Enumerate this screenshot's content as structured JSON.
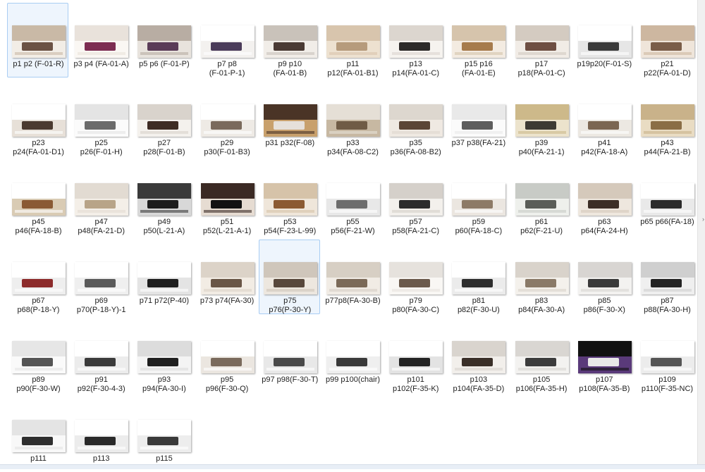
{
  "window": {
    "scroll_arrow": "›"
  },
  "catalog": [
    {
      "line1": "p1 p2 (F-01-R)",
      "line2": "",
      "selected": true,
      "palette": [
        "#c9b9a6",
        "#f2ede6",
        "#6b5244"
      ]
    },
    {
      "line1": "p3 p4 (FA-01-A)",
      "line2": "",
      "palette": [
        "#e9e2db",
        "#faf7f3",
        "#7d2d52"
      ]
    },
    {
      "line1": "p5 p6 (F-01-P)",
      "line2": "",
      "palette": [
        "#b8ada3",
        "#e8e3dd",
        "#5a3c58"
      ]
    },
    {
      "line1": "p7 p8",
      "line2": "(F-01-P-1)",
      "palette": [
        "#ffffff",
        "#f3f1ef",
        "#4b3c5a"
      ]
    },
    {
      "line1": "p9 p10",
      "line2": "(FA-01-B)",
      "palette": [
        "#c9c2ba",
        "#f1ede8",
        "#4a3a34"
      ]
    },
    {
      "line1": "p11",
      "line2": "p12(FA-01-B1)",
      "palette": [
        "#d8c5ad",
        "#ede1d0",
        "#b69b7c"
      ]
    },
    {
      "line1": "p13",
      "line2": "p14(FA-01-C)",
      "palette": [
        "#dcd6cf",
        "#f6f3ef",
        "#2d2a29"
      ]
    },
    {
      "line1": "p15 p16",
      "line2": "(FA-01-E)",
      "palette": [
        "#d6c4ac",
        "#f3ebe1",
        "#a67b4c"
      ]
    },
    {
      "line1": "p17",
      "line2": "p18(PA-01-C)",
      "palette": [
        "#d4cbc1",
        "#f1ece6",
        "#6e4f43"
      ]
    },
    {
      "line1": "p19p20(F-01-S)",
      "line2": "",
      "palette": [
        "#ffffff",
        "#e6e6e6",
        "#3a3a3a"
      ]
    },
    {
      "line1": "p21",
      "line2": "p22(FA-01-D)",
      "palette": [
        "#cdb7a0",
        "#efe5da",
        "#7a5d48"
      ]
    },
    {
      "line1": "p23",
      "line2": "p24(FA-01-D1)",
      "palette": [
        "#ffffff",
        "#e7e0d8",
        "#4b3a30"
      ]
    },
    {
      "line1": "p25",
      "line2": "p26(F-01-H)",
      "palette": [
        "#e4e4e4",
        "#fbfbfb",
        "#6c6c6c"
      ]
    },
    {
      "line1": "p27",
      "line2": "p28(F-01-B)",
      "palette": [
        "#d9d3cc",
        "#f4f1ed",
        "#3e2c24"
      ]
    },
    {
      "line1": "p29",
      "line2": "p30(F-01-B3)",
      "palette": [
        "#ffffff",
        "#eeeae5",
        "#7a6a5c"
      ]
    },
    {
      "line1": "p31 p32(F-08)",
      "line2": "",
      "palette": [
        "#4a3426",
        "#c8a06c",
        "#e6e0da"
      ]
    },
    {
      "line1": "p33",
      "line2": "p34(FA-08-C2)",
      "palette": [
        "#e5dfd6",
        "#c7b8a2",
        "#6f5b45"
      ]
    },
    {
      "line1": "p35",
      "line2": "p36(FA-08-B2)",
      "palette": [
        "#ddd7cf",
        "#efe9e2",
        "#5b4536"
      ]
    },
    {
      "line1": "p37 p38(FA-21)",
      "line2": "",
      "palette": [
        "#e9e9e9",
        "#fbfbfb",
        "#5e5e5e"
      ]
    },
    {
      "line1": "p39",
      "line2": "p40(FA-21-1)",
      "palette": [
        "#cdb98a",
        "#ece3cc",
        "#3d3a33"
      ]
    },
    {
      "line1": "p41",
      "line2": "p42(FA-18-A)",
      "palette": [
        "#ffffff",
        "#ece8e2",
        "#7b6652"
      ]
    },
    {
      "line1": "p43",
      "line2": "p44(FA-21-B)",
      "palette": [
        "#c9b28a",
        "#e9dcc3",
        "#8a6e46"
      ]
    },
    {
      "line1": "p45",
      "line2": "p46(FA-18-B)",
      "palette": [
        "#ffffff",
        "#d9cbb4",
        "#8a5a34"
      ]
    },
    {
      "line1": "p47",
      "line2": "p48(FA-21-D)",
      "palette": [
        "#e2dbd2",
        "#f4efe8",
        "#b8a488"
      ]
    },
    {
      "line1": "p49",
      "line2": "p50(L-21-A)",
      "palette": [
        "#3a3a3a",
        "#d8d8d8",
        "#1c1c1c"
      ]
    },
    {
      "line1": "p51",
      "line2": "p52(L-21-A-1)",
      "palette": [
        "#3b2a24",
        "#e6dcd2",
        "#121212"
      ]
    },
    {
      "line1": "p53",
      "line2": "p54(F-23-L-99)",
      "palette": [
        "#d6c3a9",
        "#efe6da",
        "#8b5a32"
      ]
    },
    {
      "line1": "p55",
      "line2": "p56(F-21-W)",
      "palette": [
        "#ffffff",
        "#e8e8e8",
        "#6d6d6d"
      ]
    },
    {
      "line1": "p57",
      "line2": "p58(FA-21-C)",
      "palette": [
        "#d5d0ca",
        "#f3f0ec",
        "#2c2c2c"
      ]
    },
    {
      "line1": "p59",
      "line2": "p60(FA-18-C)",
      "palette": [
        "#ffffff",
        "#ebe6e0",
        "#8d7a66"
      ]
    },
    {
      "line1": "p61",
      "line2": "p62(F-21-U)",
      "palette": [
        "#c8cbc6",
        "#eef0ec",
        "#5a5d58"
      ]
    },
    {
      "line1": "p63",
      "line2": "p64(FA-24-H)",
      "palette": [
        "#d5c9bb",
        "#eee7de",
        "#3c2e26"
      ]
    },
    {
      "line1": "p65 p66(FA-18)",
      "line2": "",
      "palette": [
        "#ffffff",
        "#e9e9e9",
        "#2b2b2b"
      ]
    },
    {
      "line1": "p67",
      "line2": "p68(P-18-Y)",
      "palette": [
        "#ffffff",
        "#eeeeee",
        "#8c2b2b"
      ]
    },
    {
      "line1": "p69",
      "line2": "p70(P-18-Y)-1",
      "palette": [
        "#ffffff",
        "#efefef",
        "#5a5a5a"
      ]
    },
    {
      "line1": "p71 p72(P-40)",
      "line2": "",
      "palette": [
        "#ffffff",
        "#e4e4e4",
        "#1e1e1e"
      ]
    },
    {
      "line1": "p73 p74(FA-30)",
      "line2": "",
      "palette": [
        "#dcd3c8",
        "#f2ece4",
        "#6a5646"
      ]
    },
    {
      "line1": "p75",
      "line2": "p76(P-30-Y)",
      "selected": true,
      "palette": [
        "#cfc6bb",
        "#ede7df",
        "#58483c"
      ]
    },
    {
      "line1": "p77p8(FA-30-B)",
      "line2": "",
      "palette": [
        "#d7cfc4",
        "#f1ece5",
        "#7b6a58"
      ]
    },
    {
      "line1": "p79",
      "line2": "p80(FA-30-C)",
      "palette": [
        "#e6e2dd",
        "#f9f7f4",
        "#6b5a4c"
      ]
    },
    {
      "line1": "p81",
      "line2": "p82(F-30-U)",
      "palette": [
        "#ffffff",
        "#ebebeb",
        "#2d2d2d"
      ]
    },
    {
      "line1": "p83",
      "line2": "p84(FA-30-A)",
      "palette": [
        "#d9d3cb",
        "#f4f1ec",
        "#8a7a68"
      ]
    },
    {
      "line1": "p85",
      "line2": "p86(F-30-X)",
      "palette": [
        "#d8d5d2",
        "#f3f2f0",
        "#3a3a3a"
      ]
    },
    {
      "line1": "p87",
      "line2": "p88(FA-30-H)",
      "palette": [
        "#cfcfcf",
        "#efefef",
        "#242424"
      ]
    },
    {
      "line1": "p89",
      "line2": "p90(F-30-W)",
      "palette": [
        "#e6e6e6",
        "#fafafa",
        "#555555"
      ]
    },
    {
      "line1": "p91",
      "line2": "p92(F-30-4-3)",
      "palette": [
        "#ffffff",
        "#ececec",
        "#3b3b3b"
      ]
    },
    {
      "line1": "p93",
      "line2": "p94(FA-30-I)",
      "palette": [
        "#dcdcdc",
        "#f4f4f4",
        "#1f1f1f"
      ]
    },
    {
      "line1": "p95",
      "line2": "p96(F-30-Q)",
      "palette": [
        "#ffffff",
        "#ebe6e0",
        "#7a6a5c"
      ]
    },
    {
      "line1": "p97 p98(F-30-T)",
      "line2": "",
      "palette": [
        "#ffffff",
        "#e8e8e8",
        "#4a4a4a"
      ]
    },
    {
      "line1": "p99 p100(chair)",
      "line2": "",
      "palette": [
        "#ffffff",
        "#efefef",
        "#3a3a3a"
      ]
    },
    {
      "line1": "p101",
      "line2": "p102(F-35-K)",
      "palette": [
        "#ffffff",
        "#e3e3e3",
        "#232323"
      ]
    },
    {
      "line1": "p103",
      "line2": "p104(FA-35-D)",
      "palette": [
        "#d9d4ce",
        "#f2efeb",
        "#3a2f28"
      ]
    },
    {
      "line1": "p105",
      "line2": "p106(FA-35-H)",
      "palette": [
        "#d9d6d2",
        "#f3f2f0",
        "#3c3c3c"
      ]
    },
    {
      "line1": "p107",
      "line2": "p108(FA-35-B)",
      "palette": [
        "#111111",
        "#5a3a7a",
        "#e8e8e8"
      ]
    },
    {
      "line1": "p109",
      "line2": "p110(F-35-NC)",
      "palette": [
        "#ffffff",
        "#ececec",
        "#555555"
      ]
    },
    {
      "line1": "p111",
      "line2": "",
      "palette": [
        "#e4e4e4",
        "#f8f8f8",
        "#2e2e2e"
      ]
    },
    {
      "line1": "p113",
      "line2": "",
      "palette": [
        "#ffffff",
        "#ececec",
        "#2a2a2a"
      ]
    },
    {
      "line1": "p115",
      "line2": "",
      "palette": [
        "#ffffff",
        "#ededed",
        "#3a3a3a"
      ]
    }
  ]
}
